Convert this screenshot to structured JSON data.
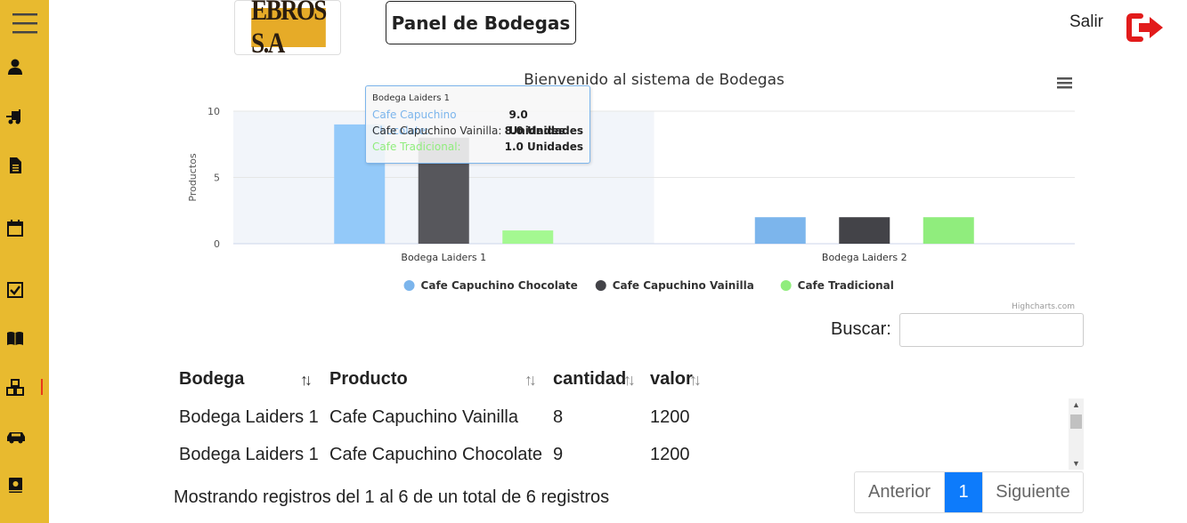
{
  "sidebar": {
    "icons": [
      "menu-icon",
      "user-icon",
      "forklift-icon",
      "document-icon",
      "calendar-icon",
      "checkbox-icon",
      "book-open-icon",
      "boxes-icon",
      "car-icon",
      "book-icon"
    ],
    "accent": "#e8ba2f",
    "active_marker_color": "#e9391a"
  },
  "header": {
    "logo_text": "EBROS S.A",
    "title": "Panel de Bodegas",
    "logout_label": "Salir",
    "logout_icon": "sign-out-icon",
    "logout_color": "#e21b1b"
  },
  "chart_data": {
    "type": "bar",
    "title": "Bienvenido al sistema de Bodegas",
    "ylabel": "Productos",
    "xlabel": "",
    "ylim": [
      0,
      10
    ],
    "yticks": [
      0,
      5,
      10
    ],
    "categories": [
      "Bodega Laiders 1",
      "Bodega Laiders 2"
    ],
    "series": [
      {
        "name": "Cafe Capuchino Chocolate",
        "values": [
          9,
          2
        ],
        "color": "#7cb5ec",
        "highlight_color": "#93c9f9"
      },
      {
        "name": "Cafe Capuchino Vainilla",
        "values": [
          8,
          2
        ],
        "color": "#434348",
        "highlight_color": "#57575c"
      },
      {
        "name": "Cafe Tradicional",
        "values": [
          1,
          2
        ],
        "color": "#90ed7d",
        "highlight_color": "#a4f891"
      }
    ],
    "legend_position": "bottom",
    "grid": true,
    "credits": "Highcharts.com",
    "menu_icon": "hamburger-menu-icon",
    "hovered_category": "Bodega Laiders 1",
    "tooltip": {
      "header": "Bodega Laiders 1",
      "rows": [
        {
          "label": "Cafe Capuchino Chocolate:",
          "value": "9.0 Unidades",
          "color": "#7cb5ec"
        },
        {
          "label": "Cafe Capuchino Vainilla:",
          "value": "8.0 Unidades",
          "color": "#333333"
        },
        {
          "label": "Cafe Tradicional:",
          "value": "1.0 Unidades",
          "color": "#90ed7d"
        }
      ]
    }
  },
  "search": {
    "label": "Buscar:",
    "value": ""
  },
  "table": {
    "columns": [
      "Bodega",
      "Producto",
      "cantidad",
      "valor"
    ],
    "rows": [
      [
        "Bodega Laiders 1",
        "Cafe Capuchino Vainilla",
        "8",
        "1200"
      ],
      [
        "Bodega Laiders 1",
        "Cafe Capuchino Chocolate",
        "9",
        "1200"
      ]
    ],
    "info": "Mostrando registros del 1 al 6 de un total de 6 registros"
  },
  "pagination": {
    "prev": "Anterior",
    "page": "1",
    "next": "Siguiente",
    "active_color": "#0d7bfb"
  }
}
